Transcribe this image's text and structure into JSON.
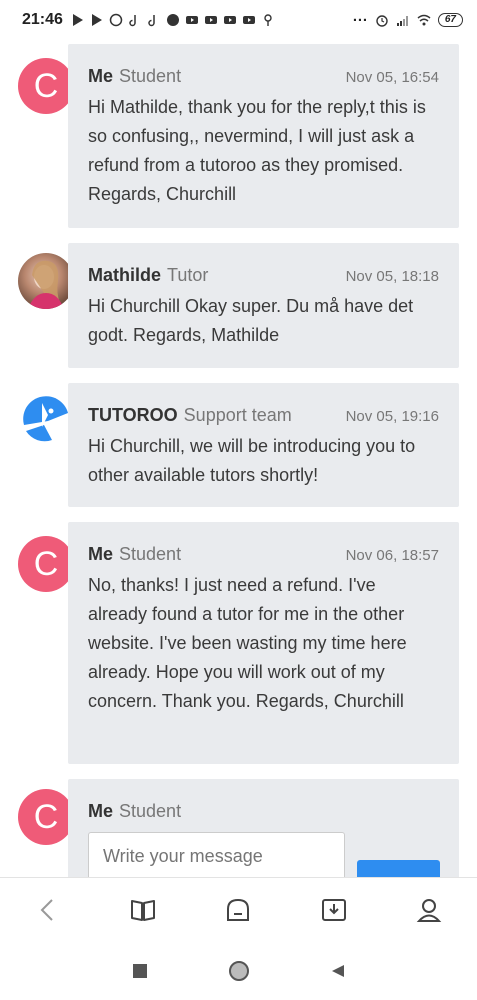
{
  "status_bar": {
    "time": "21:46",
    "battery": "67"
  },
  "messages": [
    {
      "name": "Me",
      "role": "Student",
      "date": "Nov 05, 16:54",
      "avatar_letter": "C",
      "text": "Hi Mathilde, thank you for the reply,t this is so confusing,, nevermind, I will just ask a refund from a tutoroo as they promised. Regards, Churchill"
    },
    {
      "name": "Mathilde",
      "role": "Tutor",
      "date": "Nov 05, 18:18",
      "text": "Hi Churchill Okay super. Du må have det godt. Regards, Mathilde"
    },
    {
      "name": "TUTOROO",
      "role": "Support team",
      "date": "Nov 05, 19:16",
      "text": "Hi Churchill, we will be introducing you to other available tutors shortly!"
    },
    {
      "name": "Me",
      "role": "Student",
      "date": "Nov 06, 18:57",
      "avatar_letter": "C",
      "text": "No, thanks! I just need a refund. I've already found a tutor for me in the other website. I've been wasting my time here already. Hope you will work out of my concern. Thank you. Regards, Churchill"
    }
  ],
  "composer": {
    "name": "Me",
    "role": "Student",
    "avatar_letter": "C",
    "placeholder": "Write your message"
  },
  "colors": {
    "student_avatar": "#ef5b78",
    "bubble": "#e9ebee",
    "logo_blue": "#2e8df0"
  }
}
